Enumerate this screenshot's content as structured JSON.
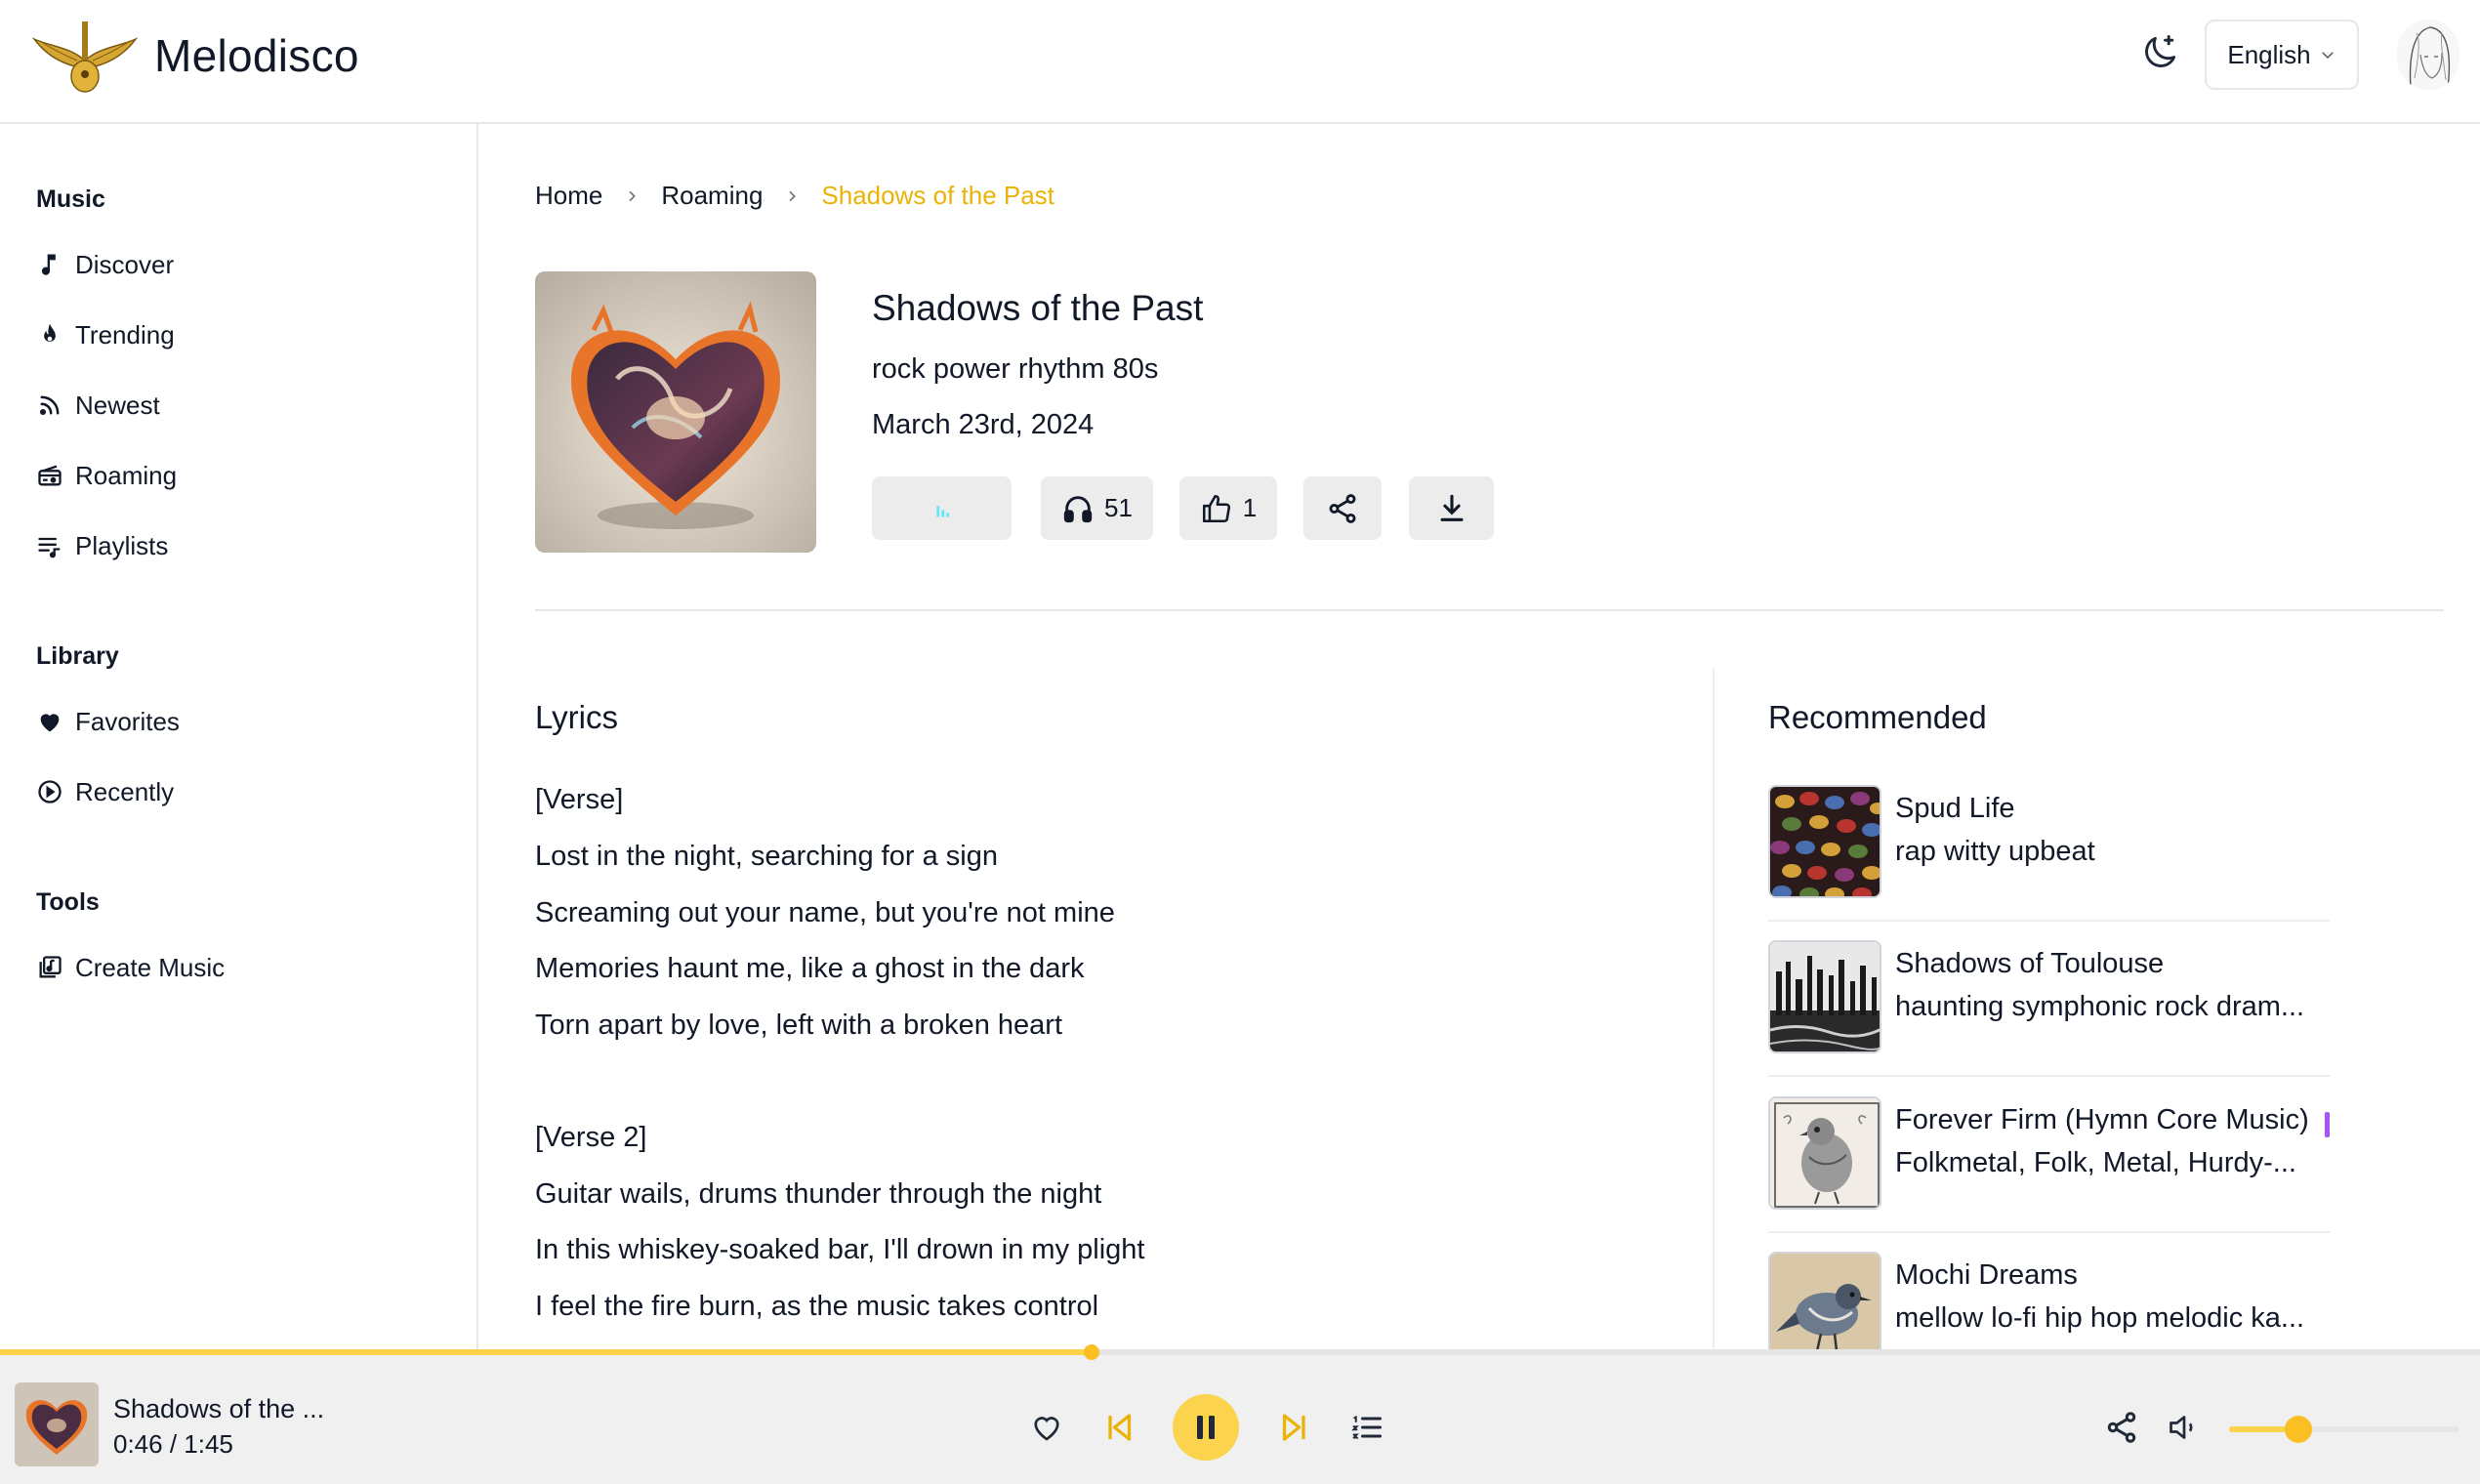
{
  "app": {
    "name": "Melodisco"
  },
  "header": {
    "language": "English"
  },
  "sidebar": {
    "sections": [
      {
        "title": "Music",
        "items": [
          {
            "label": "Discover",
            "icon": "music-note-icon"
          },
          {
            "label": "Trending",
            "icon": "flame-icon"
          },
          {
            "label": "Newest",
            "icon": "rss-icon"
          },
          {
            "label": "Roaming",
            "icon": "radio-icon"
          },
          {
            "label": "Playlists",
            "icon": "playlist-icon"
          }
        ]
      },
      {
        "title": "Library",
        "items": [
          {
            "label": "Favorites",
            "icon": "heart-icon"
          },
          {
            "label": "Recently",
            "icon": "play-circle-icon"
          }
        ]
      },
      {
        "title": "Tools",
        "items": [
          {
            "label": "Create Music",
            "icon": "create-music-icon"
          }
        ]
      }
    ]
  },
  "breadcrumb": {
    "home": "Home",
    "section": "Roaming",
    "current": "Shadows of the Past"
  },
  "song": {
    "title": "Shadows of the Past",
    "tags": "rock power rhythm 80s",
    "date": "March 23rd, 2024",
    "listens": "51",
    "likes": "1"
  },
  "lyrics": {
    "title": "Lyrics",
    "lines": [
      "[Verse]",
      "Lost in the night, searching for a sign",
      "Screaming out your name, but you're not mine",
      "Memories haunt me, like a ghost in the dark",
      "Torn apart by love, left with a broken heart",
      "",
      "[Verse 2]",
      "Guitar wails, drums thunder through the night",
      "In this whiskey-soaked bar, I'll drown in my plight",
      "I feel the fire burn, as the music takes control"
    ]
  },
  "recommended": {
    "title": "Recommended",
    "items": [
      {
        "name": "Spud Life",
        "desc": "rap witty upbeat"
      },
      {
        "name": "Shadows of Toulouse",
        "desc": "haunting symphonic rock dram..."
      },
      {
        "name": "Forever Firm (Hymn Core Music)",
        "desc": "Folkmetal, Folk, Metal, Hurdy-..."
      },
      {
        "name": "Mochi Dreams",
        "desc": "mellow lo-fi hip hop melodic ka..."
      }
    ]
  },
  "player": {
    "title": "Shadows of the ...",
    "time": "0:46 / 1:45",
    "progress": 0.44,
    "volume": 0.3,
    "state": "playing"
  },
  "colors": {
    "accent": "#eab308",
    "accent_light": "#fcd34d",
    "button_bg": "#ececec"
  }
}
